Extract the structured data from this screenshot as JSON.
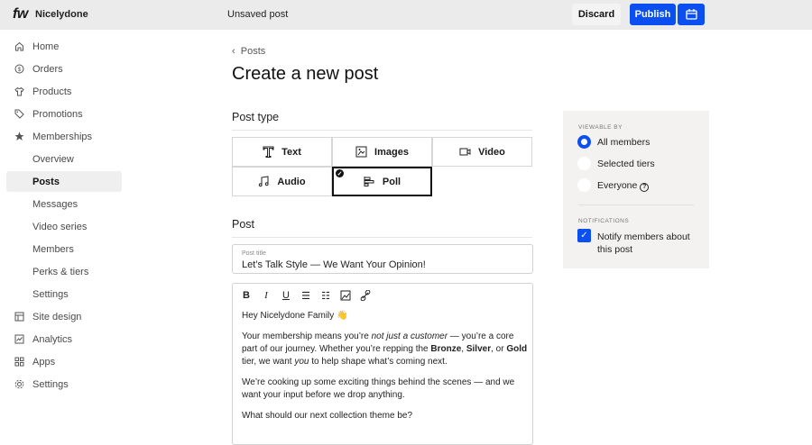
{
  "header": {
    "logo": "fw",
    "store": "Nicelydone",
    "status": "Unsaved post",
    "discard": "Discard",
    "publish": "Publish",
    "schedule_icon": "calendar-icon"
  },
  "sidebar": {
    "items": [
      {
        "label": "Home",
        "icon": "home-icon"
      },
      {
        "label": "Orders",
        "icon": "dollar-circle-icon"
      },
      {
        "label": "Products",
        "icon": "shirt-icon"
      },
      {
        "label": "Promotions",
        "icon": "tag-icon"
      },
      {
        "label": "Memberships",
        "icon": "star-icon"
      },
      {
        "label": "Overview"
      },
      {
        "label": "Posts",
        "active": true
      },
      {
        "label": "Messages"
      },
      {
        "label": "Video series"
      },
      {
        "label": "Members"
      },
      {
        "label": "Perks & tiers"
      },
      {
        "label": "Settings"
      },
      {
        "label": "Site design",
        "icon": "layout-icon"
      },
      {
        "label": "Analytics",
        "icon": "chart-icon"
      },
      {
        "label": "Apps",
        "icon": "apps-icon"
      },
      {
        "label": "Settings",
        "icon": "gear-icon"
      }
    ]
  },
  "main": {
    "breadcrumb": "Posts",
    "title": "Create a new post",
    "post_type_heading": "Post type",
    "post_types": [
      {
        "label": "Text",
        "icon": "text-icon"
      },
      {
        "label": "Images",
        "icon": "image-icon"
      },
      {
        "label": "Video",
        "icon": "video-icon"
      },
      {
        "label": "Audio",
        "icon": "music-icon"
      },
      {
        "label": "Poll",
        "icon": "poll-icon",
        "selected": true
      }
    ],
    "post_heading": "Post",
    "post_title_label": "Post title",
    "post_title_value": "Let’s Talk Style — We Want Your Opinion!",
    "toolbar": [
      "B",
      "I",
      "U",
      "bullet-list",
      "numbered-list",
      "image",
      "link"
    ],
    "body": {
      "greeting": "Hey Nicelydone Family 👋",
      "p1": [
        "Your membership means you’re ",
        "not just a customer",
        " — you’re a core part of our journey. Whether you’re repping the ",
        "Bronze",
        ", ",
        "Silver",
        ", or ",
        "Gold",
        " tier, we want ",
        "you",
        " to help shape what’s coming next."
      ],
      "p2": "We’re cooking up some exciting things behind the scenes — and we want your input before we drop anything.",
      "p3": "What should our next collection theme be?"
    }
  },
  "panel": {
    "viewable_by": "VIEWABLE BY",
    "options": [
      "All members",
      "Selected tiers",
      "Everyone"
    ],
    "selected": "All members",
    "notifications": "NOTIFICATIONS",
    "notify_label": "Notify members about this post",
    "notify_checked": true
  },
  "colors": {
    "accent": "#0b4ff0",
    "topbar": "#ebebeb",
    "panel": "#f3f2f0"
  }
}
